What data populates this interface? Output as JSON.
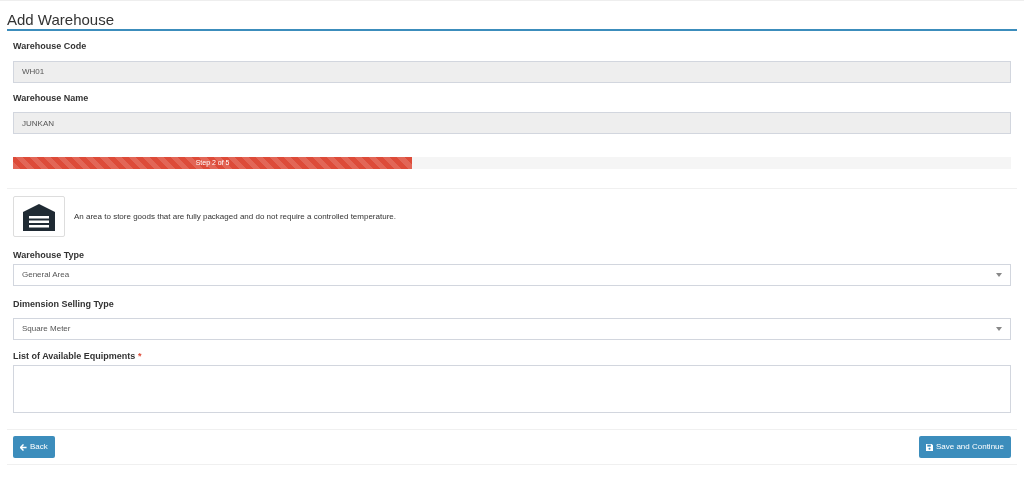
{
  "title": "Add Warehouse",
  "fields": [
    {
      "label": "Warehouse Code",
      "value": "WH01",
      "disabled": true
    },
    {
      "label": "Warehouse Name",
      "value": "JUNKAN",
      "disabled": true
    }
  ],
  "progress": {
    "label": "Step 2 of 5",
    "level": 0.4
  },
  "type_description": "An area to store goods that are fully packaged and do not require a controlled temperature.",
  "selects": [
    {
      "label": "Warehouse Type",
      "value": "General Area"
    },
    {
      "label": "Dimension Selling Type",
      "value": "Square Meter"
    }
  ],
  "equipments": {
    "label": "List of Available Equipments",
    "required_mark": "*"
  },
  "buttons": {
    "back": "Back",
    "save": "Save and Continue"
  }
}
